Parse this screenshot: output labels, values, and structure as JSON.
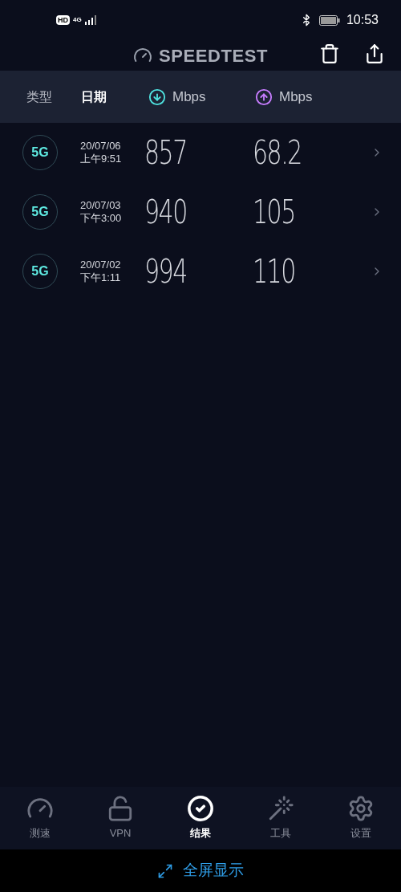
{
  "status_bar": {
    "hd": "HD",
    "network": "4G",
    "time": "10:53"
  },
  "app_bar": {
    "title": "SPEEDTEST"
  },
  "columns": [
    {
      "kind": "sort",
      "label": "类型",
      "selected": false
    },
    {
      "kind": "sort",
      "label": "日期",
      "selected": true
    },
    {
      "kind": "download",
      "label": "Mbps",
      "color": "#4fe3e0"
    },
    {
      "kind": "upload",
      "label": "Mbps",
      "color": "#c77dff"
    }
  ],
  "results": [
    {
      "type": "5G",
      "date": "20/07/06",
      "time": "上午9:51",
      "download": "857",
      "upload": "68.2"
    },
    {
      "type": "5G",
      "date": "20/07/03",
      "time": "下午3:00",
      "download": "940",
      "upload": "105"
    },
    {
      "type": "5G",
      "date": "20/07/02",
      "time": "下午1:11",
      "download": "994",
      "upload": "110"
    }
  ],
  "nav": [
    {
      "kind": "speed",
      "label": "测速",
      "selected": false
    },
    {
      "kind": "vpn",
      "label": "VPN",
      "selected": false
    },
    {
      "kind": "results",
      "label": "结果",
      "selected": true
    },
    {
      "kind": "tools",
      "label": "工具",
      "selected": false
    },
    {
      "kind": "settings",
      "label": "设置",
      "selected": false
    }
  ],
  "fullscreen_bar": {
    "label": "全屏显示"
  }
}
